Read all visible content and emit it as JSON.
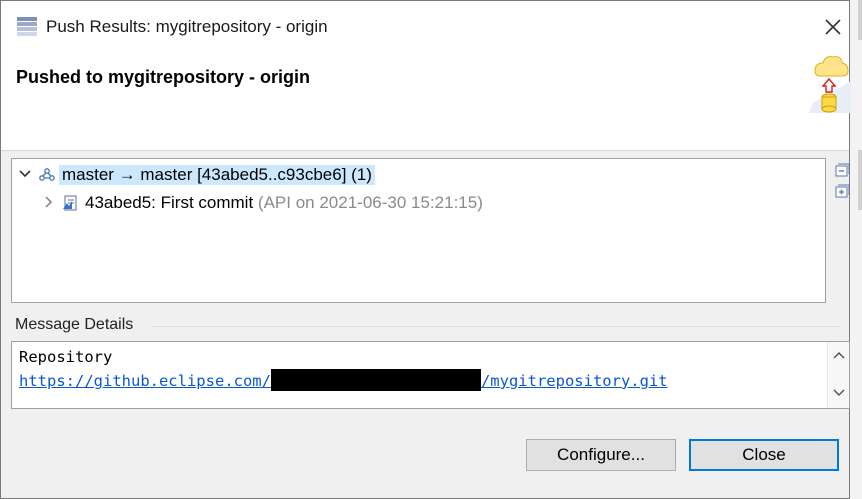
{
  "window": {
    "title": "Push Results: mygitrepository - origin"
  },
  "header": {
    "title": "Pushed to mygitrepository - origin"
  },
  "tree": {
    "root": {
      "label": "master → master [43abed5..c93cbe6] (1)"
    },
    "child": {
      "label": "43abed5: First commit",
      "meta": "(API on 2021-06-30 15:21:15)"
    }
  },
  "message_details": {
    "label": "Message Details",
    "line1": "Repository",
    "url_prefix": "https://github.eclipse.com/",
    "url_suffix": "/mygitrepository.git"
  },
  "buttons": {
    "configure": "Configure...",
    "close": "Close"
  },
  "icons": {
    "title": "stack-icon",
    "header": "push-to-cloud-icon",
    "root": "branch-icon",
    "child": "commit-icon",
    "collapse_all": "collapse-all-icon",
    "expand_all": "expand-all-icon"
  },
  "colors": {
    "selection": "#cce8ff",
    "link": "#0b57d0",
    "default_button_border": "#0078d7"
  }
}
